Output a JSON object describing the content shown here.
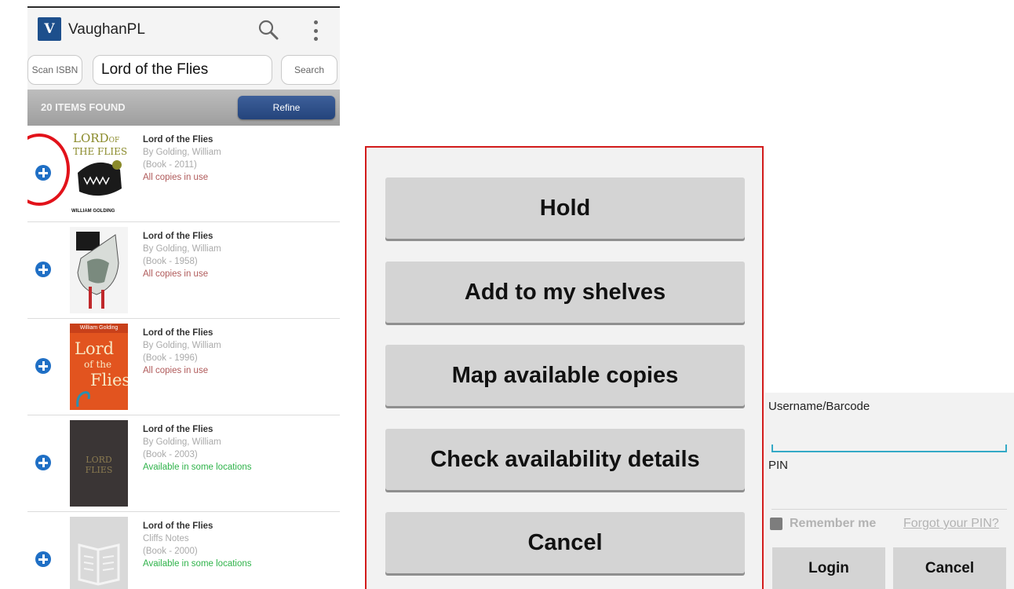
{
  "app": {
    "title": "VaughanPL",
    "logo_text": "V"
  },
  "search": {
    "scan_label": "Scan ISBN",
    "query": "Lord of the Flies",
    "search_label": "Search"
  },
  "results": {
    "count_label": "20 ITEMS FOUND",
    "refine_label": "Refine",
    "items": [
      {
        "title": "Lord of the Flies",
        "author": "By Golding, William",
        "format": "(Book - 2011)",
        "status": "All copies in use",
        "status_type": "unavailable"
      },
      {
        "title": "Lord of the Flies",
        "author": "By Golding, William",
        "format": "(Book - 1958)",
        "status": "All copies in use",
        "status_type": "unavailable"
      },
      {
        "title": "Lord of the Flies",
        "author": "By Golding, William",
        "format": "(Book - 1996)",
        "status": "All copies in use",
        "status_type": "unavailable"
      },
      {
        "title": "Lord of the Flies",
        "author": "By Golding, William",
        "format": "(Book - 2003)",
        "status": "Available in some locations",
        "status_type": "available"
      },
      {
        "title": "Lord of the Flies",
        "author": "Cliffs Notes",
        "format": "(Book - 2000)",
        "status": "Available in some locations",
        "status_type": "available"
      }
    ],
    "covers": {
      "c1_line1": "LORD",
      "c1_line2": "OF",
      "c1_line3": "THE FLIES",
      "c1_author": "WILLIAM GOLDING",
      "c3_author": "William Golding",
      "c3_line1": "Lord",
      "c3_line2": "of the",
      "c3_line3": "Flies",
      "c4_line1": "LORD",
      "c4_line2": "FLIES"
    }
  },
  "actions": {
    "hold": "Hold",
    "add_shelves": "Add to my shelves",
    "map_copies": "Map available copies",
    "check_details": "Check availability details",
    "cancel": "Cancel"
  },
  "login": {
    "username_label": "Username/Barcode",
    "pin_label": "PIN",
    "remember_label": "Remember me",
    "forgot_label": "Forgot your PIN?",
    "login_label": "Login",
    "cancel_label": "Cancel"
  },
  "colors": {
    "brand": "#1d4f8c",
    "highlight": "#e2121a",
    "available": "#2fb34a",
    "unavailable": "#b05a5a",
    "focus": "#34a9c6"
  }
}
